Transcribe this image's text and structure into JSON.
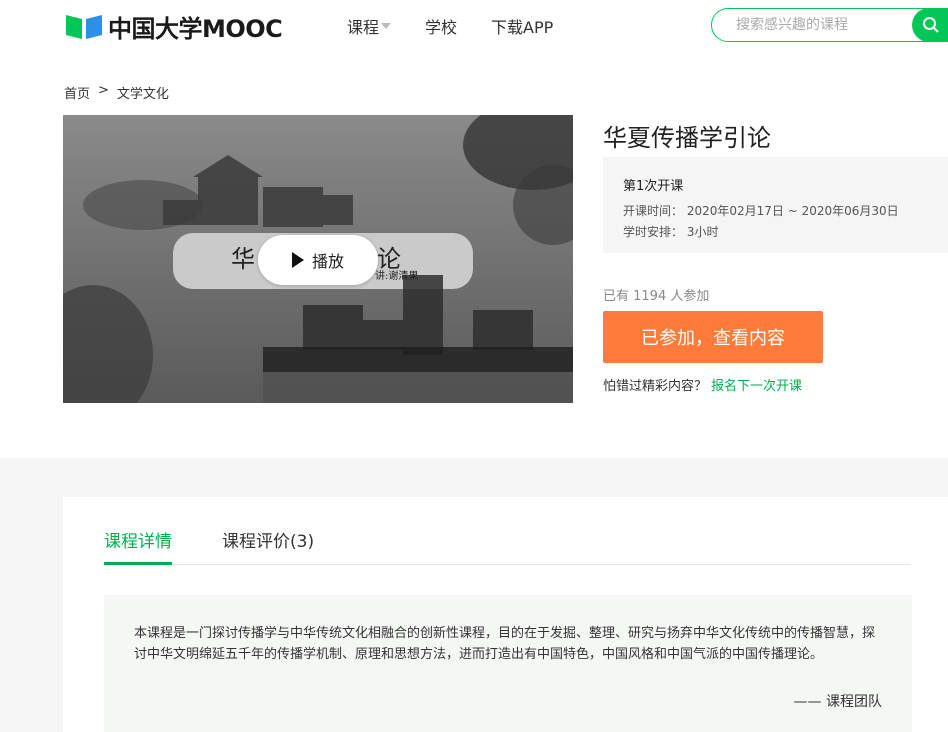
{
  "header": {
    "logo_text": "中国大学MOOC",
    "nav": [
      {
        "label": "课程",
        "has_dropdown": true
      },
      {
        "label": "学校",
        "has_dropdown": false
      },
      {
        "label": "下载APP",
        "has_dropdown": false
      }
    ],
    "search": {
      "placeholder": "搜索感兴趣的课程",
      "icon": "search-icon"
    }
  },
  "breadcrumb": {
    "home": "首页",
    "separator": ">",
    "category": "文学文化"
  },
  "video": {
    "title_left": "华",
    "title_right": "论",
    "author_fragment": "讲:谢清果",
    "play_label": "播放"
  },
  "course": {
    "title": "华夏传播学引论",
    "term": {
      "name": "第1次开课",
      "time_label": "开课时间：",
      "time_value": "2020年02月17日 ~ 2020年06月30日",
      "hours_label": "学时安排：",
      "hours_value": "3小时"
    },
    "participants": "已有 1194 人参加",
    "join_button": "已参加，查看内容",
    "next_term_prompt": "怕错过精彩内容？",
    "next_term_link": "报名下一次开课"
  },
  "details": {
    "tabs": [
      {
        "label": "课程详情",
        "active": true
      },
      {
        "label": "课程评价(3)",
        "active": false
      }
    ],
    "description": "本课程是一门探讨传播学与中华传统文化相融合的创新性课程，目的在于发掘、整理、研究与扬弃中华文化传统中的传播智慧，探讨中华文明绵延五千年的传播学机制、原理和思想方法，进而打造出有中国特色，中国风格和中国气派的中国传播理论。",
    "signature": "—— 课程团队"
  },
  "colors": {
    "brand_green": "#00c758",
    "accent_orange": "#ff7b3b",
    "link_green": "#00b050"
  }
}
